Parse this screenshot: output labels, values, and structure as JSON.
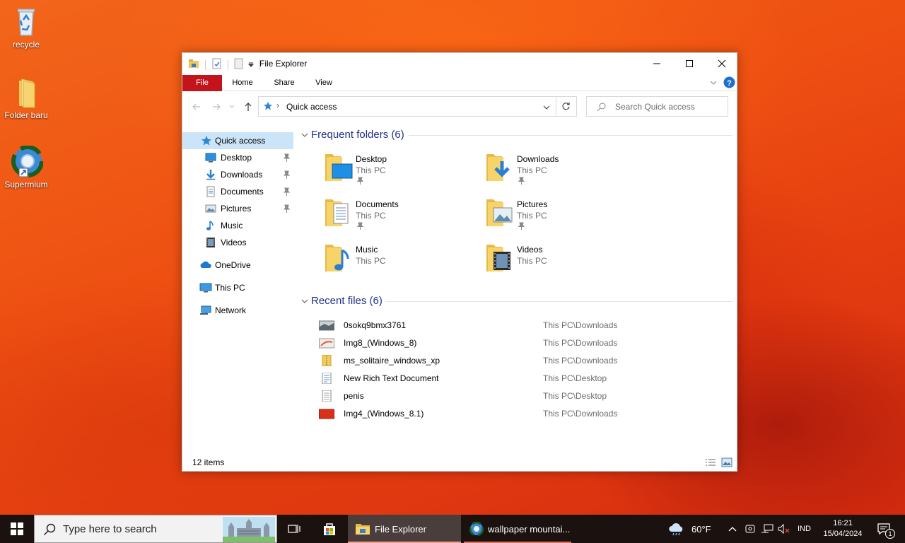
{
  "desktop": {
    "icons": [
      {
        "label": "recycle"
      },
      {
        "label": "Folder baru"
      },
      {
        "label": "Supermium"
      }
    ]
  },
  "window": {
    "title": "File Explorer",
    "ribbon_tabs": [
      "File",
      "Home",
      "Share",
      "View"
    ],
    "address": {
      "crumb": "Quick access"
    },
    "search_placeholder": "Search Quick access",
    "sidebar": {
      "quick_access": "Quick access",
      "items": [
        {
          "label": "Desktop",
          "icon": "desktop-icon",
          "pinned": true
        },
        {
          "label": "Downloads",
          "icon": "downloads-icon",
          "pinned": true
        },
        {
          "label": "Documents",
          "icon": "documents-icon",
          "pinned": true
        },
        {
          "label": "Pictures",
          "icon": "pictures-icon",
          "pinned": true
        },
        {
          "label": "Music",
          "icon": "music-icon",
          "pinned": false
        },
        {
          "label": "Videos",
          "icon": "videos-icon",
          "pinned": false
        }
      ],
      "onedrive": "OneDrive",
      "this_pc": "This PC",
      "network": "Network"
    },
    "frequent": {
      "header": "Frequent folders (6)",
      "folders": [
        {
          "name": "Desktop",
          "location": "This PC",
          "pinned": true
        },
        {
          "name": "Downloads",
          "location": "This PC",
          "pinned": true
        },
        {
          "name": "Documents",
          "location": "This PC",
          "pinned": true
        },
        {
          "name": "Pictures",
          "location": "This PC",
          "pinned": true
        },
        {
          "name": "Music",
          "location": "This PC",
          "pinned": false
        },
        {
          "name": "Videos",
          "location": "This PC",
          "pinned": false
        }
      ]
    },
    "recent": {
      "header": "Recent files (6)",
      "files": [
        {
          "name": "0sokq9bmx3761",
          "path": "This PC\\Downloads",
          "icon": "image-icon"
        },
        {
          "name": "Img8_(Windows_8)",
          "path": "This PC\\Downloads",
          "icon": "image-icon"
        },
        {
          "name": "ms_solitaire_windows_xp",
          "path": "This PC\\Downloads",
          "icon": "zip-folder-icon"
        },
        {
          "name": "New Rich Text Document",
          "path": "This PC\\Desktop",
          "icon": "rtf-document-icon"
        },
        {
          "name": "penis",
          "path": "This PC\\Desktop",
          "icon": "text-document-icon"
        },
        {
          "name": "Img4_(Windows_8.1)",
          "path": "This PC\\Downloads",
          "icon": "image-icon"
        }
      ]
    },
    "status": {
      "count": "12 items"
    }
  },
  "taskbar": {
    "search_placeholder": "Type here to search",
    "apps": [
      {
        "label": "File Explorer",
        "active": true
      },
      {
        "label": "wallpaper mountai...",
        "active": false
      }
    ],
    "weather": "60°F",
    "language": "IND",
    "time": "16:21",
    "date": "15/04/2024",
    "notification_count": "1"
  },
  "colors": {
    "file_tab": "#c4131a",
    "selection": "#cce4f7",
    "group_header": "#1e3287",
    "taskbar": "#1b1210"
  }
}
